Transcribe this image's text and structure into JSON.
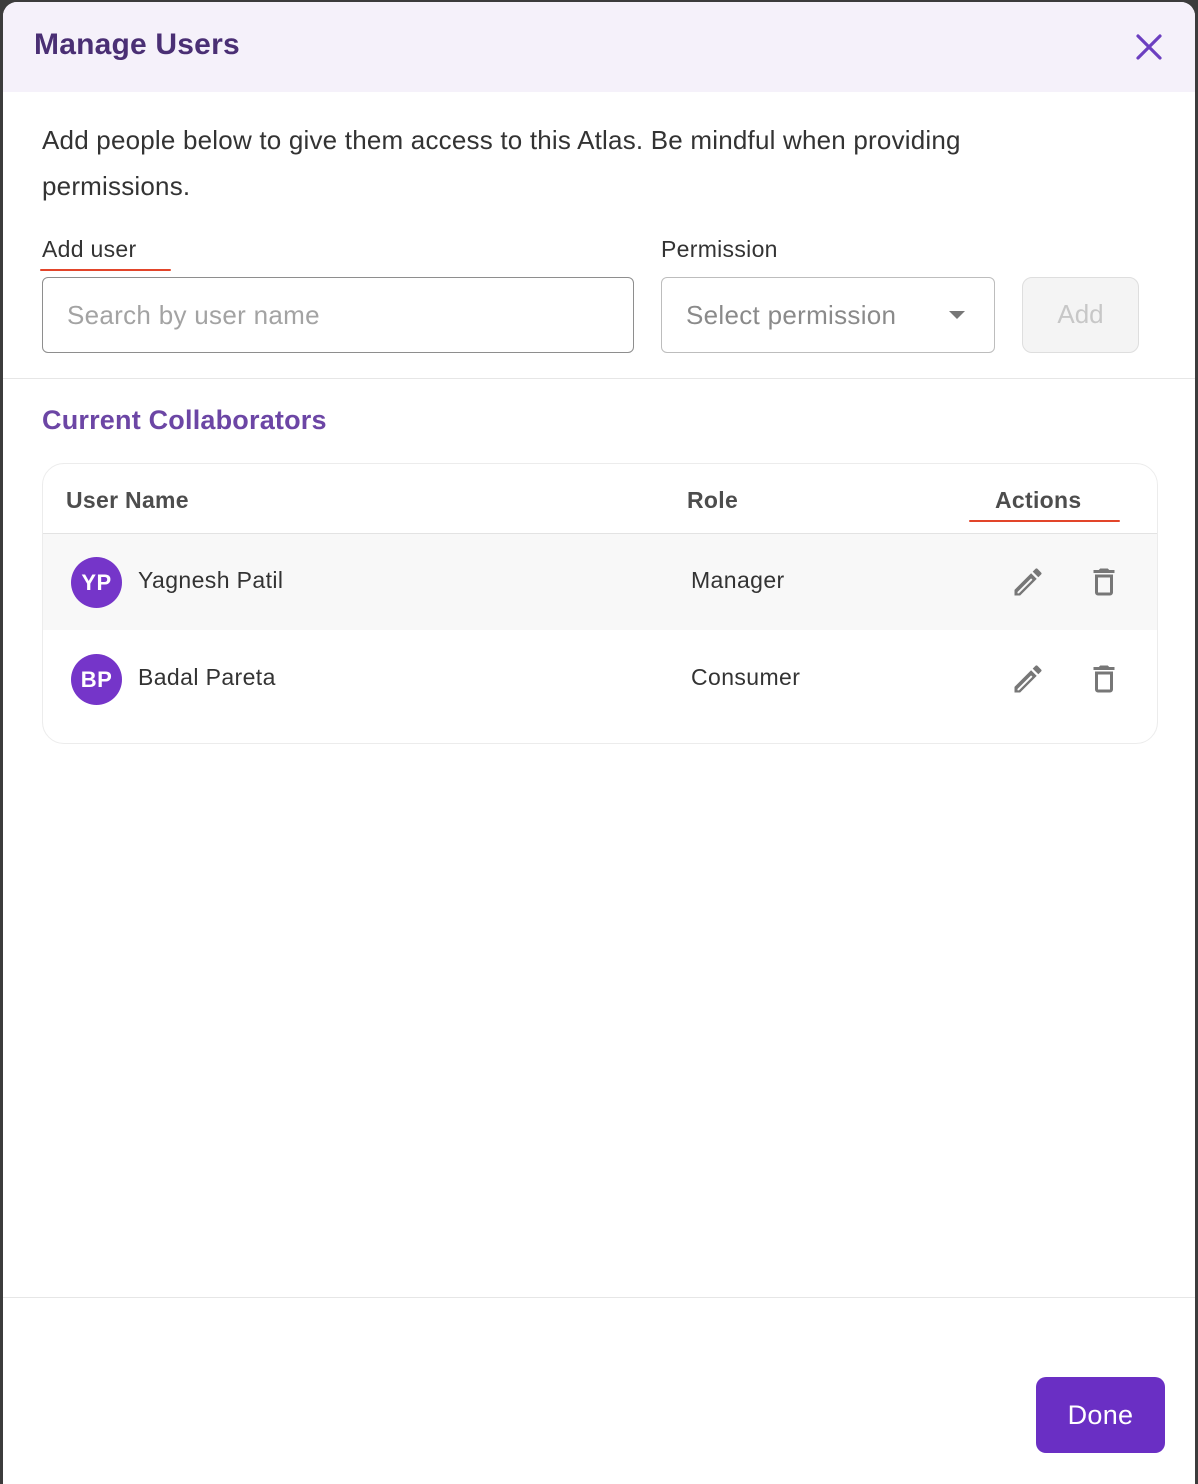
{
  "dialog": {
    "title": "Manage Users",
    "intro": "Add people below to give them access to this Atlas. Be mindful when providing permissions."
  },
  "add_user": {
    "label": "Add user",
    "placeholder": "Search by user name",
    "value": ""
  },
  "permission": {
    "label": "Permission",
    "placeholder": "Select permission"
  },
  "add_button": {
    "label": "Add",
    "disabled": true
  },
  "collaborators": {
    "title": "Current Collaborators",
    "columns": [
      "User Name",
      "Role",
      "Actions"
    ],
    "rows": [
      {
        "initials": "YP",
        "name": "Yagnesh Patil",
        "role": "Manager"
      },
      {
        "initials": "BP",
        "name": "Badal Pareta",
        "role": "Consumer"
      }
    ]
  },
  "footer": {
    "done_label": "Done"
  },
  "icons": {
    "close": "close-icon",
    "caret": "chevron-down-icon",
    "edit": "pencil-icon",
    "delete": "trash-icon"
  },
  "colors": {
    "accent": "#6a2fc4",
    "avatar": "#7535c9",
    "title": "#4a2f74",
    "section_title": "#6c46a5",
    "header_bg": "#f5f1fa",
    "annotation_underline": "#e2452a"
  }
}
